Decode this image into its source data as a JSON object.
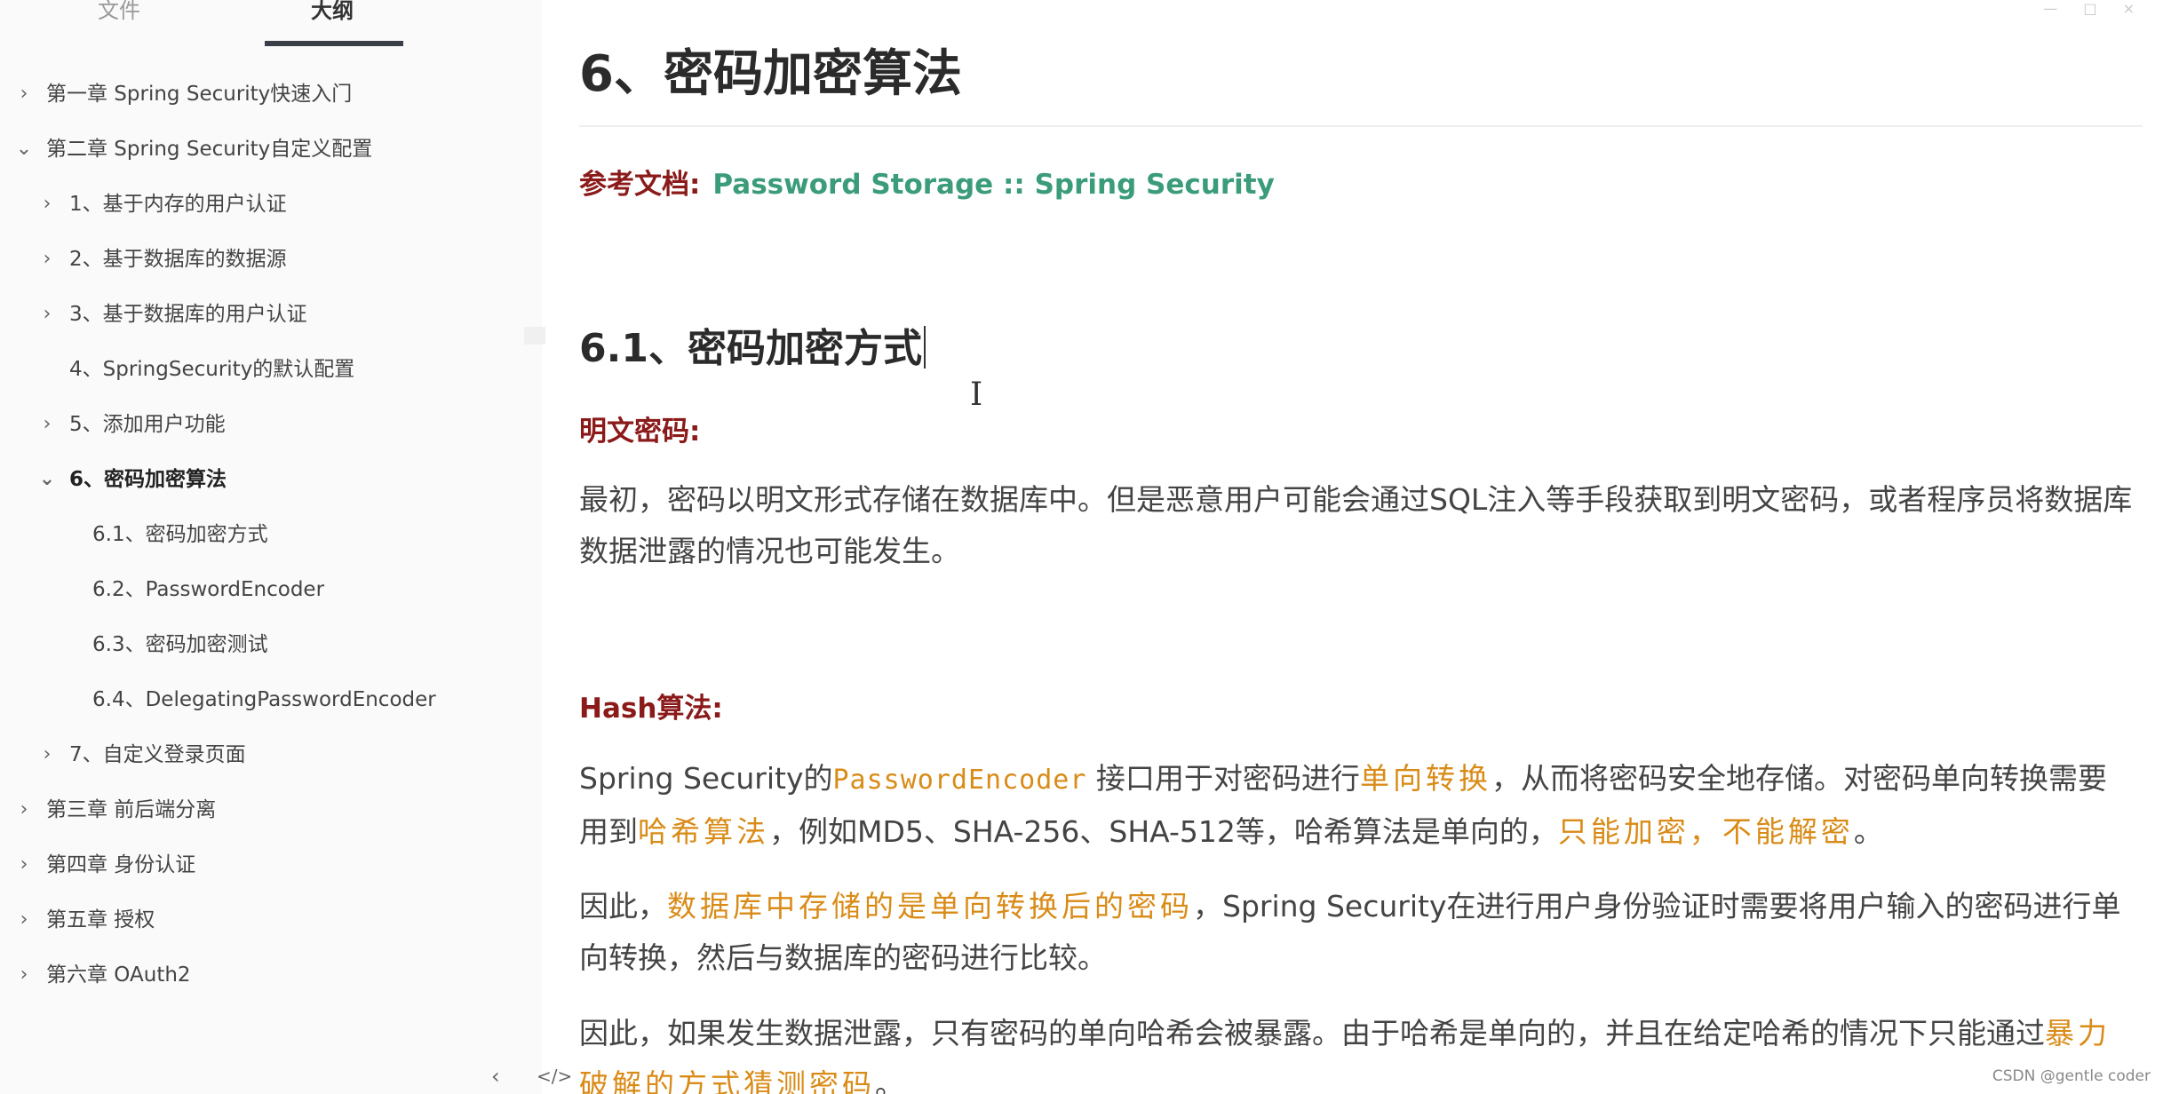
{
  "sidebar": {
    "tabs": {
      "files": "文件",
      "outline": "大纲"
    },
    "outline": [
      {
        "label": "第一章 Spring Security快速入门",
        "level": 1,
        "chevron": "chevron-right-icon"
      },
      {
        "label": "第二章 Spring Security自定义配置",
        "level": 1,
        "chevron": "chevron-down-icon"
      },
      {
        "label": "1、基于内存的用户认证",
        "level": 2,
        "chevron": "chevron-right-icon"
      },
      {
        "label": "2、基于数据库的数据源",
        "level": 2,
        "chevron": "chevron-right-icon"
      },
      {
        "label": "3、基于数据库的用户认证",
        "level": 2,
        "chevron": "chevron-right-icon"
      },
      {
        "label": "4、SpringSecurity的默认配置",
        "level": 2,
        "chevron": ""
      },
      {
        "label": "5、添加用户功能",
        "level": 2,
        "chevron": "chevron-right-icon"
      },
      {
        "label": "6、密码加密算法",
        "level": 2,
        "chevron": "chevron-down-icon",
        "active": true
      },
      {
        "label": "6.1、密码加密方式",
        "level": 3,
        "chevron": ""
      },
      {
        "label": "6.2、PasswordEncoder",
        "level": 3,
        "chevron": ""
      },
      {
        "label": "6.3、密码加密测试",
        "level": 3,
        "chevron": ""
      },
      {
        "label": "6.4、DelegatingPasswordEncoder",
        "level": 3,
        "chevron": ""
      },
      {
        "label": "7、自定义登录页面",
        "level": 2,
        "chevron": "chevron-right-icon"
      },
      {
        "label": "第三章 前后端分离",
        "level": 1,
        "chevron": "chevron-right-icon"
      },
      {
        "label": "第四章 身份认证",
        "level": 1,
        "chevron": "chevron-right-icon"
      },
      {
        "label": "第五章 授权",
        "level": 1,
        "chevron": "chevron-right-icon"
      },
      {
        "label": "第六章 OAuth2",
        "level": 1,
        "chevron": "chevron-right-icon"
      }
    ],
    "footer": {
      "toggle_icon": "‹",
      "source_icon": "</>"
    }
  },
  "content": {
    "h1": "6、密码加密算法",
    "reference": {
      "label": "参考文档:",
      "link": "Password Storage :: Spring Security"
    },
    "h2": "6.1、密码加密方式",
    "plain": {
      "heading": "明文密码:",
      "text": "最初，密码以明文形式存储在数据库中。但是恶意用户可能会通过SQL注入等手段获取到明文密码，或者程序员将数据库数据泄露的情况也可能发生。"
    },
    "hash": {
      "heading": "Hash算法:",
      "p1": {
        "a": "Spring Security的",
        "code": "PasswordEncoder",
        "b": " 接口用于对密码进行",
        "hl1": "单向转换",
        "c": "，从而将密码安全地存储。对密码单向转换需要用到",
        "hl2": "哈希算法",
        "d": "，例如MD5、SHA-256、SHA-512等，哈希算法是单向的，",
        "hl3": "只能加密，不能解密",
        "e": "。"
      },
      "p2": {
        "a": "因此，",
        "hl1": "数据库中存储的是单向转换后的密码",
        "b": "，Spring Security在进行用户身份验证时需要将用户输入的密码进行单向转换，然后与数据库的密码进行比较。"
      },
      "p3": {
        "a": "因此，如果发生数据泄露，只有密码的单向哈希会被暴露。由于哈希是单向的，并且在给定哈希的情况下只能通过",
        "hl1": "暴力破解的方式猜测密码",
        "b": "。"
      }
    }
  },
  "watermark": "CSDN @gentle coder",
  "colors": {
    "heading_red": "#8b1a1a",
    "link_green": "#3b9c7a",
    "highlight_orange": "#d98b17"
  }
}
